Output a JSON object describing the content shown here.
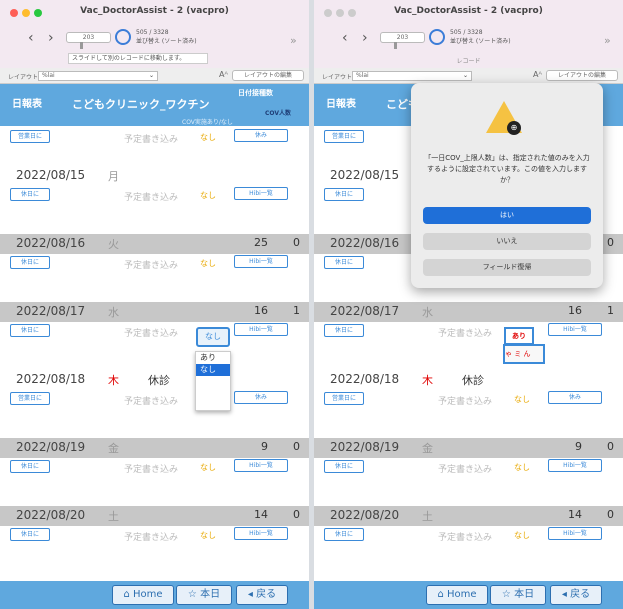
{
  "colors": {
    "accent": "#5fa8de",
    "link": "#3b8ad8",
    "red": "#e00000",
    "none": "#e8a800",
    "gray_row": "#c7c7c7",
    "traffic": [
      "#fe5f57",
      "#febc2e",
      "#28c840"
    ]
  },
  "window": {
    "title": "Vac_DoctorAssist - 2 (vacpro)",
    "slider_value": "203",
    "record_count": "505 / 3328",
    "record_sub": "並び替え (ソート済み)",
    "tooltip": "スライドして別のレコードに移動します。",
    "record_label": "レコード",
    "nav_back": "‹",
    "nav_fwd": "›",
    "ff": "»"
  },
  "layoutbar": {
    "label": "レイアウト:",
    "select": "%lai",
    "chevron": "⌄",
    "icon": "Aᴬ",
    "button": "レイアウトの編集"
  },
  "header": {
    "tab": "日報表",
    "clinic": "こどもクリニック_ワクチン",
    "col1": "日付接種数",
    "col2": "COV人数",
    "col3": "COV実施あり/なし"
  },
  "top_partial": {
    "button_left": "営業日に",
    "placeholder": "予定書き込み",
    "none": "なし",
    "button_right": "休み"
  },
  "days": [
    {
      "date": "2022/08/15",
      "weekday": "月",
      "weekday_red": false,
      "closed": "",
      "count1": "",
      "count2": "",
      "button_left": "休日に",
      "placeholder": "予定書き込み",
      "none": "なし",
      "button_right": "Hibi一覧",
      "gray": false
    },
    {
      "date": "2022/08/16",
      "weekday": "火",
      "weekday_red": false,
      "closed": "",
      "count1": "25",
      "count2": "0",
      "button_left": "休日に",
      "placeholder": "予定書き込み",
      "none": "なし",
      "button_right": "Hibi一覧",
      "gray": true
    },
    {
      "date": "2022/08/17",
      "weekday": "水",
      "weekday_red": false,
      "closed": "",
      "count1": "16",
      "count2": "1",
      "button_left": "休日に",
      "placeholder": "予定書き込み",
      "none": "",
      "button_right": "Hibi一覧",
      "gray": true
    },
    {
      "date": "2022/08/18",
      "weekday": "木",
      "weekday_red": true,
      "closed": "休診",
      "count1": "",
      "count2": "",
      "button_left": "営業日に",
      "placeholder": "予定書き込み",
      "none": "なし",
      "button_right": "休み",
      "gray": false
    },
    {
      "date": "2022/08/19",
      "weekday": "金",
      "weekday_red": false,
      "closed": "",
      "count1": "9",
      "count2": "0",
      "button_left": "休日に",
      "placeholder": "予定書き込み",
      "none": "なし",
      "button_right": "Hibi一覧",
      "gray": true
    },
    {
      "date": "2022/08/20",
      "weekday": "土",
      "weekday_red": false,
      "closed": "",
      "count1": "14",
      "count2": "0",
      "button_left": "休日に",
      "placeholder": "予定書き込み",
      "none": "なし",
      "button_right": "Hibi一覧",
      "gray": true
    }
  ],
  "dropdown": {
    "current": "なし",
    "options": [
      "あり",
      "なし"
    ],
    "selected": "なし"
  },
  "field_right": {
    "value": "あり",
    "typed": "ゃ ミ ん"
  },
  "footer": {
    "home": "Home",
    "today": "本日",
    "back": "戻る",
    "home_icon": "⌂",
    "star_icon": "☆",
    "back_icon": "◂"
  },
  "dialog": {
    "message": "「一日COV_上限人数」は、指定された値のみを入力するように設定されています。この値を入力しますか？",
    "yes": "はい",
    "no": "いいえ",
    "revert": "フィールド復帰"
  }
}
